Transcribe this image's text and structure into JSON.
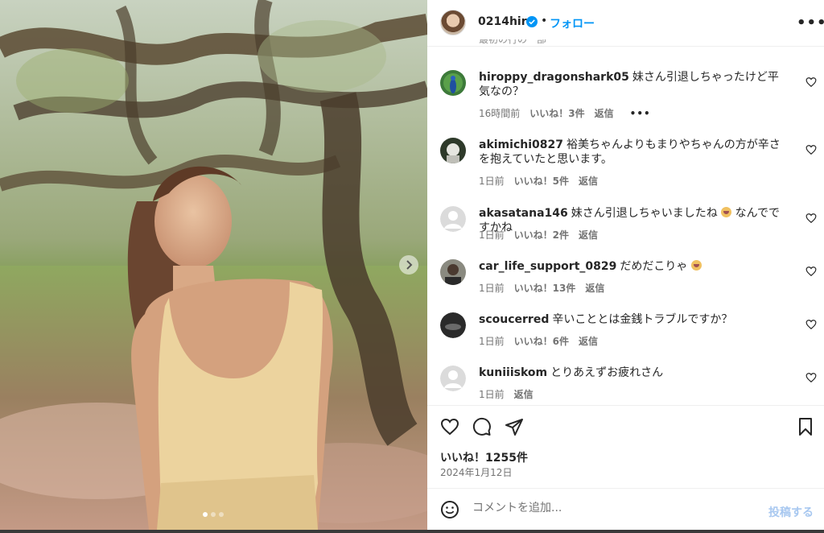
{
  "post": {
    "username": "0214hiro",
    "separator": "•",
    "follow_label": "フォロー",
    "more_label": "•••",
    "carousel": {
      "slide_count": 3,
      "active_slide": 1
    },
    "cut_off_comment": "最初の行の一部"
  },
  "comments": [
    {
      "user": "hiroppy_dragonshark05",
      "text": "妹さん引退しちゃったけど平気なの？",
      "time": "16時間前",
      "likes": "いいね！3件",
      "reply": "返信",
      "more": "•••",
      "avatar": "peacock"
    },
    {
      "user": "akimichi0827",
      "text": "裕美ちゃんよりもまりやちゃんの方が辛さを抱えていたと思います。",
      "time": "1日前",
      "likes": "いいね！5件",
      "reply": "返信",
      "avatar": "photo-dark"
    },
    {
      "user": "akasatana146",
      "text": "妹さん引退しちゃいましたね",
      "text_after": "なんでですかね",
      "time": "1日前",
      "likes": "いいね！2件",
      "reply": "返信",
      "avatar": "default"
    },
    {
      "user": "car_life_support_0829",
      "text": "だめだこりゃ",
      "time": "1日前",
      "likes": "いいね！13件",
      "reply": "返信",
      "avatar": "person"
    },
    {
      "user": "scoucerred",
      "text": "辛いこととは金銭トラブルですか？",
      "time": "1日前",
      "likes": "いいね！6件",
      "reply": "返信",
      "avatar": "dark"
    },
    {
      "user": "kuniiiskom",
      "text": "とりあえずお疲れさん",
      "time": "1日前",
      "reply": "返信",
      "avatar": "default"
    }
  ],
  "actions": {
    "likes_total": "いいね！1255件",
    "date": "2024年1月12日"
  },
  "composer": {
    "placeholder": "コメントを追加...",
    "post_label": "投稿する"
  },
  "colors": {
    "accent": "#0095f6",
    "post_disabled": "#a8c8f0",
    "meta_text": "#737373",
    "border": "#efefef"
  }
}
